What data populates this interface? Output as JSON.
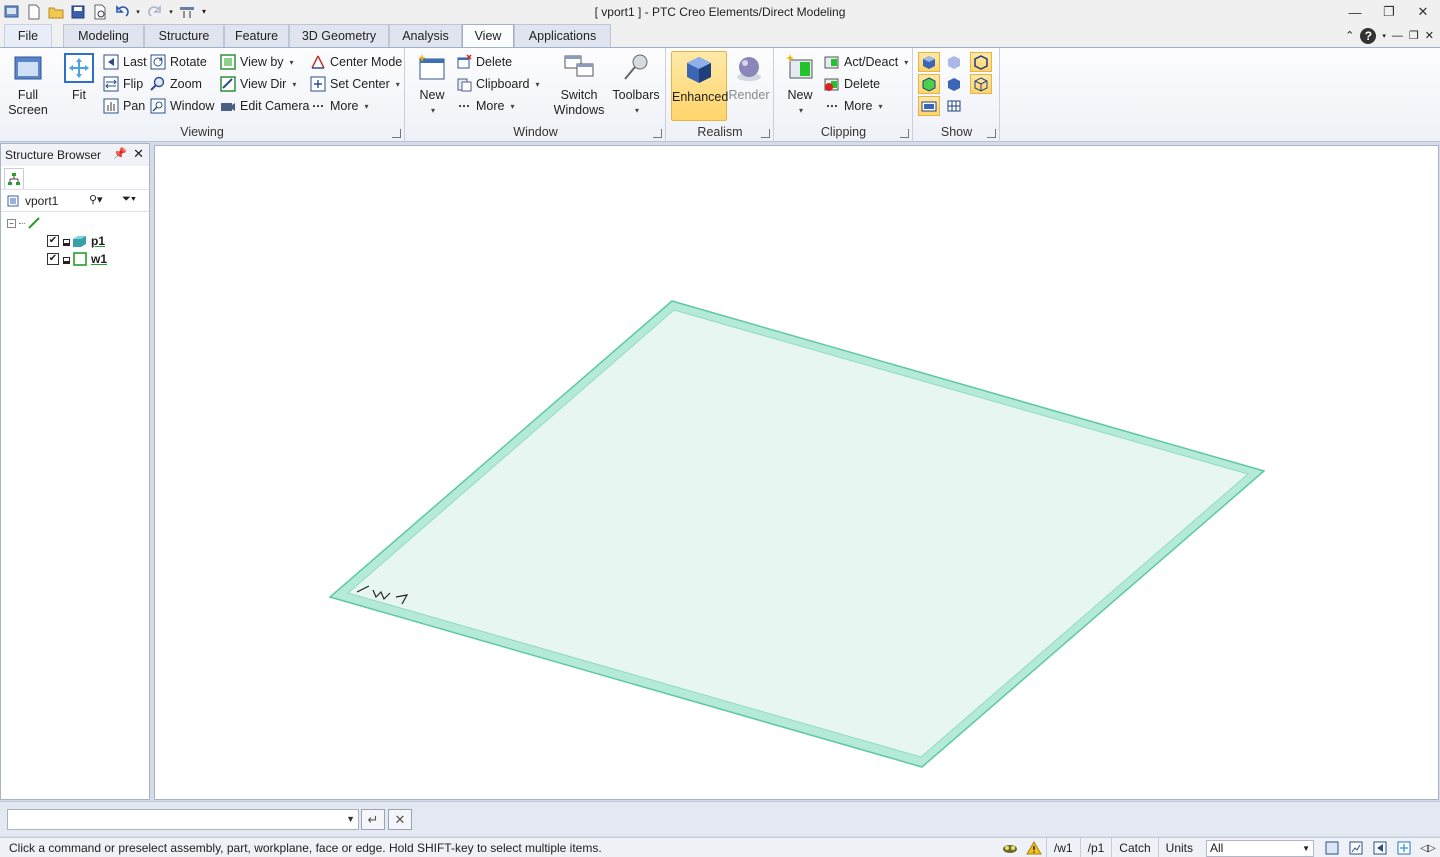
{
  "window": {
    "title": "[ vport1 ] - PTC Creo Elements/Direct Modeling",
    "min_glyph": "—",
    "max_glyph": "❐",
    "close_glyph": "✕"
  },
  "tabs": {
    "file": "File",
    "modeling": "Modeling",
    "structure": "Structure",
    "feature": "Feature",
    "geometry3d": "3D Geometry",
    "analysis": "Analysis",
    "view": "View",
    "applications": "Applications",
    "help_glyph": "?"
  },
  "ribbon": {
    "viewing": {
      "label": "Viewing",
      "full_screen": "Full Screen",
      "fit": "Fit",
      "last": "Last",
      "flip": "Flip",
      "pan": "Pan",
      "rotate": "Rotate",
      "zoom": "Zoom",
      "window": "Window",
      "view_by": "View by",
      "view_dir": "View Dir",
      "edit_camera": "Edit Camera",
      "center_mode": "Center Mode",
      "set_center": "Set Center",
      "more": "More"
    },
    "window_group": {
      "label": "Window",
      "new": "New",
      "delete": "Delete",
      "clipboard": "Clipboard",
      "more": "More",
      "switch_windows": "Switch Windows",
      "toolbars": "Toolbars"
    },
    "realism": {
      "label": "Realism",
      "enhanced": "Enhanced",
      "render": "Render"
    },
    "clipping": {
      "label": "Clipping",
      "new": "New",
      "act_deact": "Act/Deact",
      "delete": "Delete",
      "more": "More"
    },
    "show": {
      "label": "Show"
    }
  },
  "structure_browser": {
    "title": "Structure Browser",
    "viewport_name": "vport1",
    "items": [
      {
        "label": "p1",
        "checked": true,
        "type": "part"
      },
      {
        "label": "w1",
        "checked": true,
        "type": "workplane"
      }
    ]
  },
  "viewport": {
    "workplane_label": "/w1",
    "fill_color": "#e8f6f2",
    "edge_color": "#5cc9a5"
  },
  "command": {
    "input_value": "",
    "ok_glyph": "↵",
    "cancel_glyph": "✕"
  },
  "status": {
    "message": "Click a command or preselect assembly, part, workplane, face or edge. Hold SHIFT-key to select multiple items.",
    "workplane": "/w1",
    "part": "/p1",
    "catch": "Catch",
    "units": "Units",
    "select_filter": "All"
  }
}
